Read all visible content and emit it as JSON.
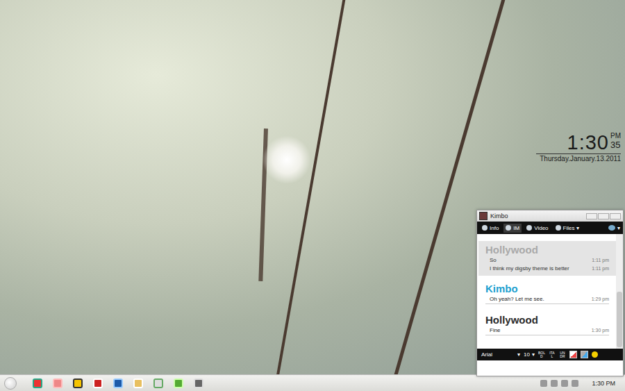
{
  "clock": {
    "time": "1:30",
    "meridiem": "PM",
    "seconds": "35",
    "date": "Thursday.January.13.2011"
  },
  "chat_window": {
    "title": "Kimbo",
    "tabs": [
      {
        "label": "Info",
        "selected": false
      },
      {
        "label": "IM",
        "selected": true
      },
      {
        "label": "Video",
        "selected": false
      },
      {
        "label": "Files",
        "selected": false,
        "caret": "▾"
      }
    ],
    "menu_caret": "▾",
    "messages": [
      {
        "sender": "Hollywood",
        "color": "#a9a9a9",
        "faded": true,
        "lines": [
          {
            "text": "So",
            "time": "1:11 pm"
          },
          {
            "text": "I think my digsby theme is better",
            "time": "1:11 pm"
          }
        ]
      },
      {
        "sender": "Kimbo",
        "color": "#1c9fcf",
        "faded": false,
        "lines": [
          {
            "text": "Oh yeah? Let me see.",
            "time": "1:29 pm"
          }
        ]
      },
      {
        "sender": "Hollywood",
        "color": "#2a2a2a",
        "faded": false,
        "lines": [
          {
            "text": "Fine",
            "time": "1:30 pm"
          }
        ]
      }
    ],
    "format_bar": {
      "font": "Arial",
      "font_caret": "▾",
      "size": "10",
      "size_caret": "▾",
      "buttons": [
        "BOLD",
        "ITAL",
        "UNDR"
      ]
    },
    "input": {
      "value": ""
    }
  },
  "taskbar": {
    "clock": "1:30 PM"
  }
}
